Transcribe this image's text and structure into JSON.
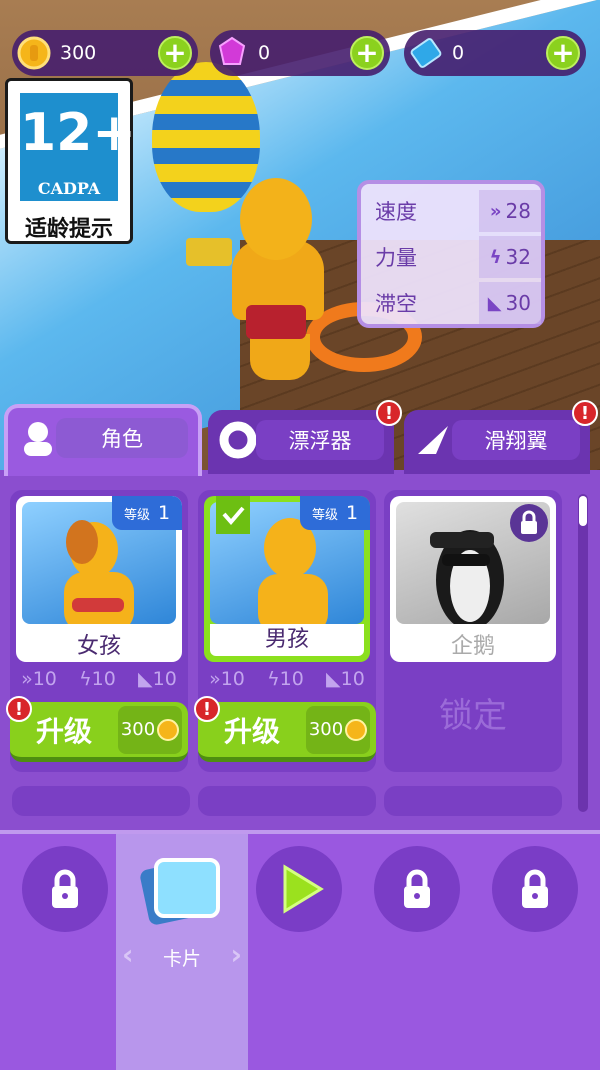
{
  "resources": {
    "coins": "300",
    "gems": "0",
    "tickets": "0"
  },
  "age_rating": {
    "rating": "12+",
    "org": "CADPA",
    "hint": "适龄提示"
  },
  "stats": [
    {
      "label": "速度",
      "icon": "double-chevron-icon",
      "value": "28"
    },
    {
      "label": "力量",
      "icon": "lightning-icon",
      "value": "32"
    },
    {
      "label": "滞空",
      "icon": "wing-icon",
      "value": "30"
    }
  ],
  "tabs": [
    {
      "label": "角色",
      "alert": ""
    },
    {
      "label": "漂浮器",
      "alert": "!"
    },
    {
      "label": "滑翔翼",
      "alert": "!"
    }
  ],
  "cards": [
    {
      "name": "女孩",
      "level_label": "等级",
      "level": "1",
      "stats": [
        "10",
        "10",
        "10"
      ],
      "upgrade": "升级",
      "cost": "300",
      "alert": "!"
    },
    {
      "name": "男孩",
      "level_label": "等级",
      "level": "1",
      "stats": [
        "10",
        "10",
        "10"
      ],
      "upgrade": "升级",
      "cost": "300",
      "alert": "!"
    },
    {
      "name": "企鹅",
      "locked_label": "锁定"
    }
  ],
  "bottom_nav": {
    "selected_label": "卡片",
    "prev_arrow": "‹",
    "next_arrow": "›"
  },
  "colors": {
    "panel": "#8b4ecf",
    "upgrade_green": "#89d01c",
    "level_blue": "#2e6cd8",
    "alert_red": "#d8262a"
  }
}
